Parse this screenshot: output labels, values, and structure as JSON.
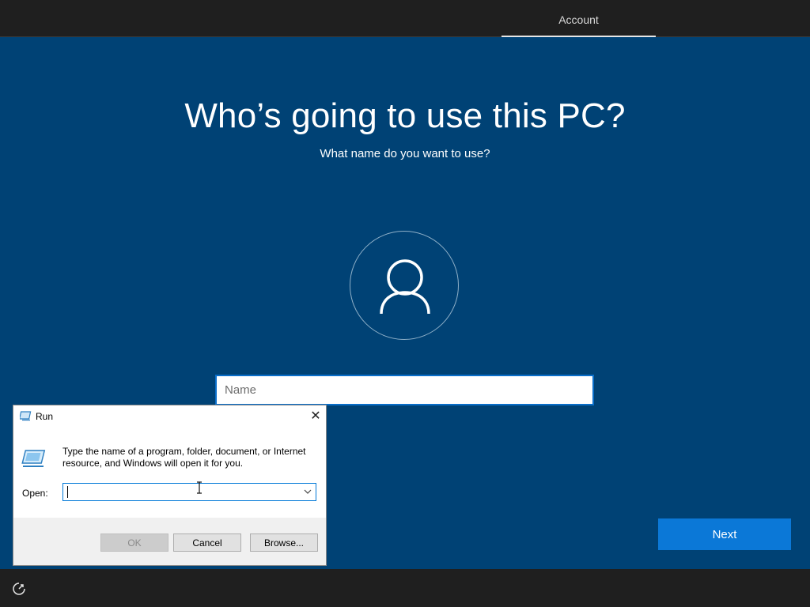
{
  "header": {
    "tab_label": "Account"
  },
  "main": {
    "title": "Who’s going to use this PC?",
    "subtitle": "What name do you want to use?",
    "name_placeholder": "Name",
    "next_label": "Next"
  },
  "run_dialog": {
    "title": "Run",
    "description": "Type the name of a program, folder, document, or Internet resource, and Windows will open it for you.",
    "open_label": "Open:",
    "open_value": "",
    "ok_label": "OK",
    "cancel_label": "Cancel",
    "browse_label": "Browse..."
  },
  "icons": {
    "avatar": "user-icon",
    "accessibility": "ease-of-access-icon",
    "run": "run-program-icon",
    "close": "close-icon",
    "dropdown": "chevron-down-icon"
  },
  "colors": {
    "background": "#004275",
    "bars": "#1f1f1f",
    "accent": "#0b78d7"
  }
}
